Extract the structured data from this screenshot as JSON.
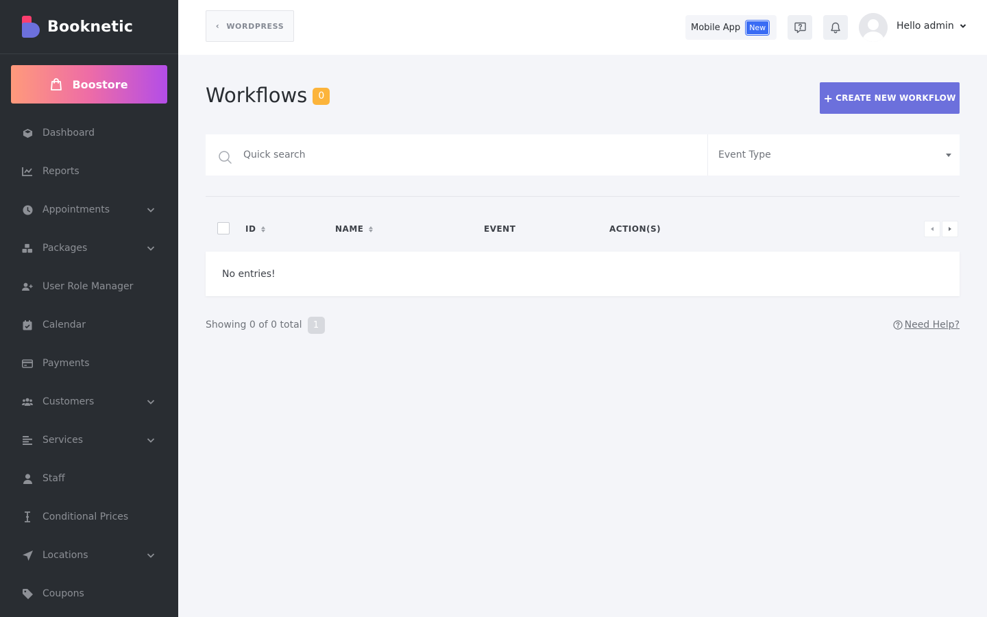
{
  "brand": {
    "name": "Booknetic"
  },
  "boostore": {
    "label": "Boostore"
  },
  "sidebar": {
    "items": [
      {
        "label": "Dashboard",
        "icon": "dashboard-icon",
        "has_submenu": false
      },
      {
        "label": "Reports",
        "icon": "chart-icon",
        "has_submenu": false
      },
      {
        "label": "Appointments",
        "icon": "clock-icon",
        "has_submenu": true
      },
      {
        "label": "Packages",
        "icon": "boxes-icon",
        "has_submenu": true
      },
      {
        "label": "User Role Manager",
        "icon": "user-plus-icon",
        "has_submenu": false
      },
      {
        "label": "Calendar",
        "icon": "calendar-icon",
        "has_submenu": false
      },
      {
        "label": "Payments",
        "icon": "credit-card-icon",
        "has_submenu": false
      },
      {
        "label": "Customers",
        "icon": "users-icon",
        "has_submenu": true
      },
      {
        "label": "Services",
        "icon": "list-icon",
        "has_submenu": true
      },
      {
        "label": "Staff",
        "icon": "user-icon",
        "has_submenu": false
      },
      {
        "label": "Conditional Prices",
        "icon": "text-cursor-icon",
        "has_submenu": false
      },
      {
        "label": "Locations",
        "icon": "location-arrow-icon",
        "has_submenu": true
      },
      {
        "label": "Coupons",
        "icon": "tag-icon",
        "has_submenu": false
      }
    ]
  },
  "header": {
    "wordpress_label": "WORDPRESS",
    "mobile_app_label": "Mobile App",
    "new_badge": "New",
    "user_greeting": "Hello admin"
  },
  "main": {
    "title": "Workflows",
    "count": "0",
    "create_button": "CREATE NEW WORKFLOW",
    "search_placeholder": "Quick search",
    "event_type_placeholder": "Event Type",
    "columns": [
      "ID",
      "NAME",
      "EVENT",
      "ACTION(S)"
    ],
    "empty_message": "No entries!",
    "showing_text": "Showing 0 of 0 total",
    "current_page": "1",
    "help_link": "Need Help?"
  },
  "colors": {
    "sidebar_bg": "#292d32",
    "accent": "#6c70dc",
    "count_badge": "#fcb43b",
    "new_badge": "#3a6cf4"
  }
}
